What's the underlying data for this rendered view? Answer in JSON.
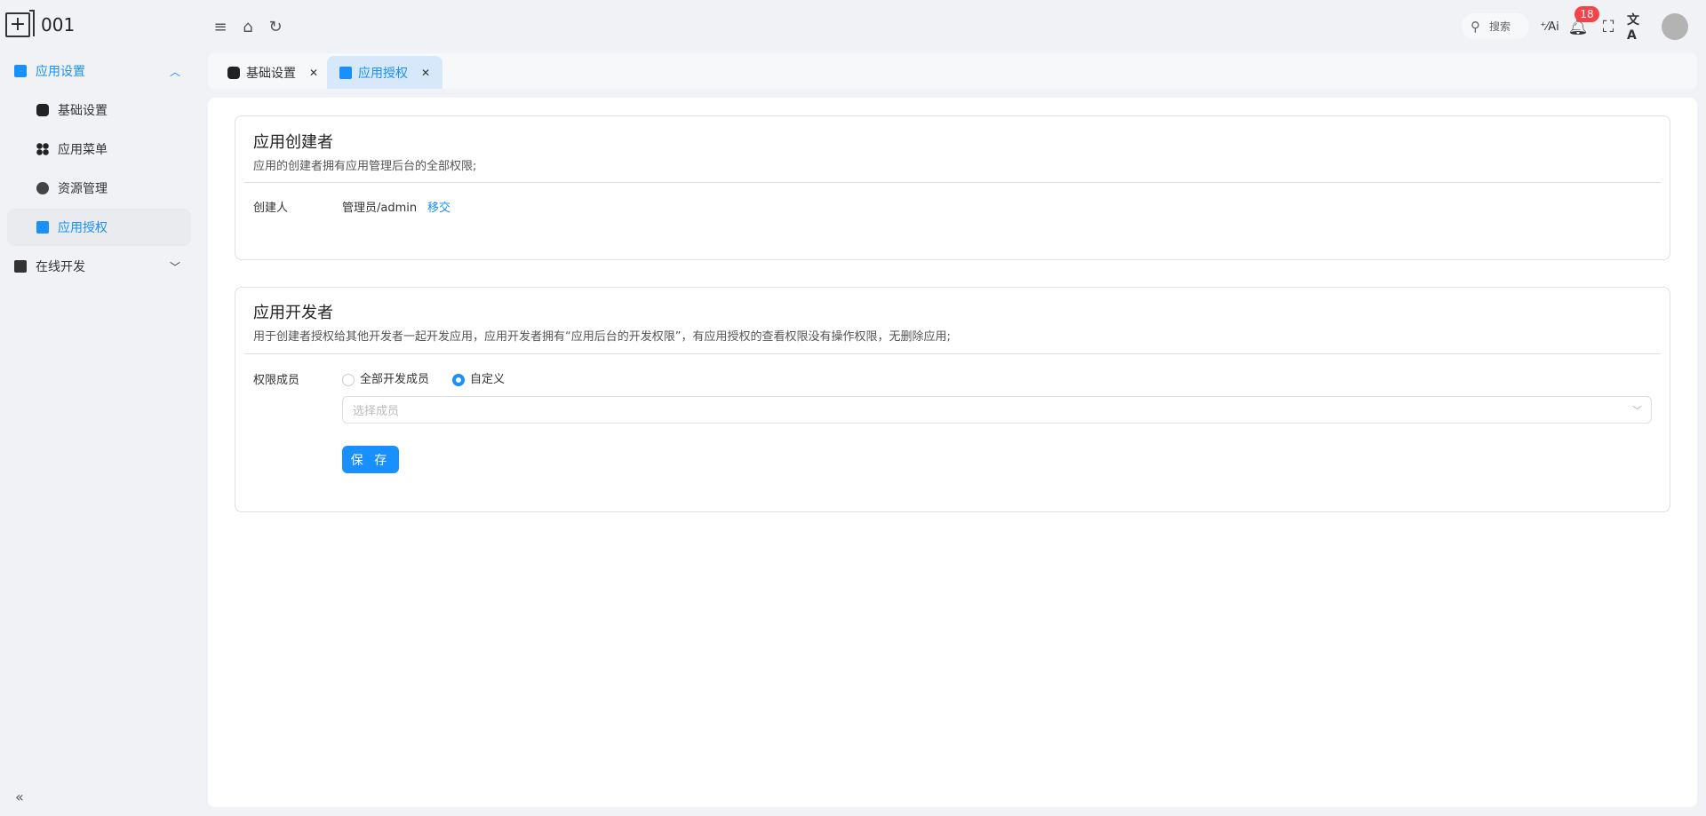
{
  "app": {
    "name": "001"
  },
  "header": {
    "search_label": "搜索",
    "notification_count": "18"
  },
  "sidebar": {
    "groups": [
      {
        "label": "应用设置",
        "expanded": true,
        "items": [
          {
            "label": "基础设置"
          },
          {
            "label": "应用菜单"
          },
          {
            "label": "资源管理"
          },
          {
            "label": "应用授权",
            "active": true
          }
        ]
      },
      {
        "label": "在线开发",
        "expanded": false
      }
    ],
    "collapse_label": "«"
  },
  "tabs": [
    {
      "label": "基础设置",
      "active": false
    },
    {
      "label": "应用授权",
      "active": true
    }
  ],
  "creator_card": {
    "title": "应用创建者",
    "description": "应用的创建者拥有应用管理后台的全部权限;",
    "creator_label": "创建人",
    "creator_value": "管理员/admin",
    "transfer_link": "移交"
  },
  "developer_card": {
    "title": "应用开发者",
    "description": "用于创建者授权给其他开发者一起开发应用，应用开发者拥有“应用后台的开发权限”，有应用授权的查看权限没有操作权限，无删除应用;",
    "members_label": "权限成员",
    "options": [
      {
        "label": "全部开发成员",
        "checked": false
      },
      {
        "label": "自定义",
        "checked": true
      }
    ],
    "select_placeholder": "选择成员",
    "save_label": "保 存"
  },
  "colors": {
    "accent": "#1890ff",
    "badge": "#f5434a"
  }
}
